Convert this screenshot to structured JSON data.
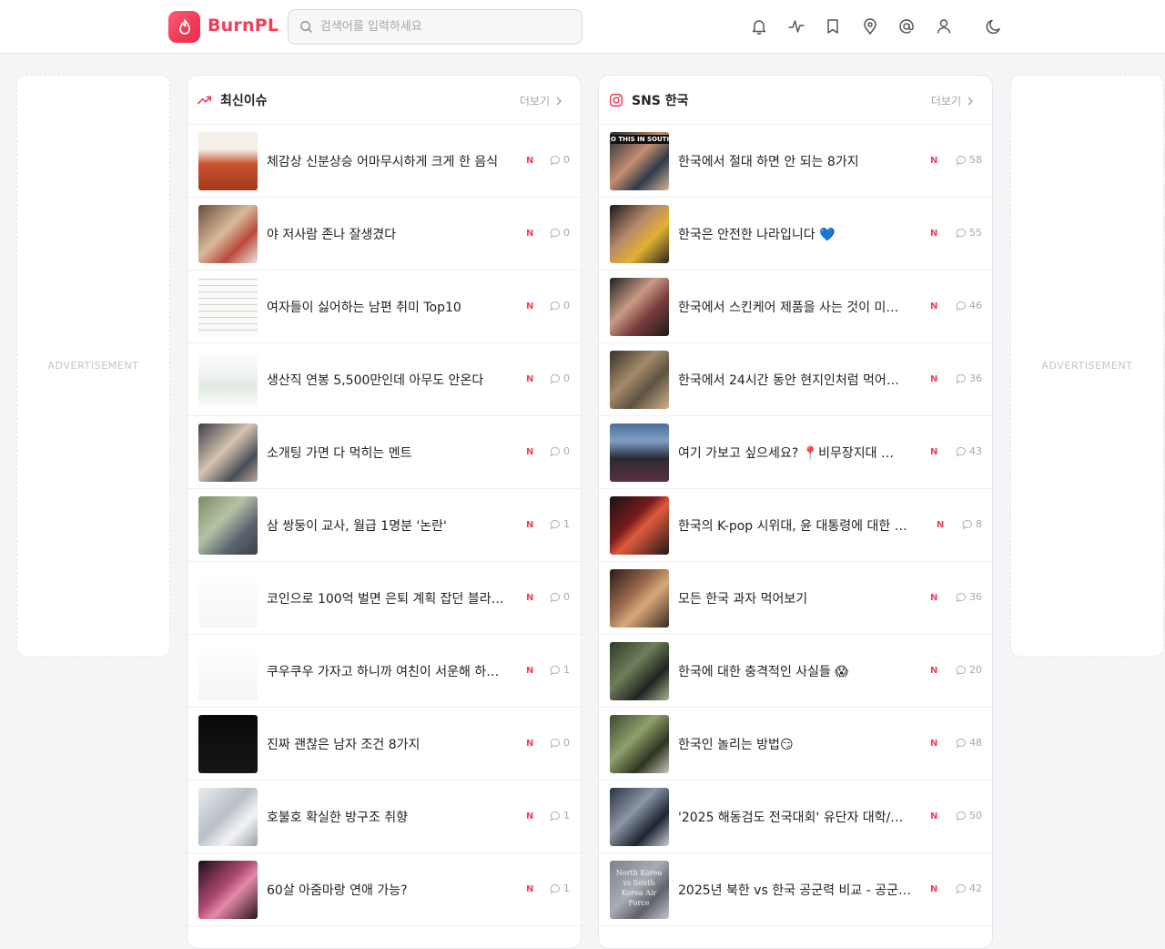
{
  "header": {
    "logo_text": "BurnPL",
    "search_placeholder": "검색어를 입력하세요",
    "icons": [
      "bell-icon",
      "activity-icon",
      "bookmark-icon",
      "map-pin-icon",
      "at-icon",
      "user-icon",
      "moon-icon"
    ]
  },
  "ads": {
    "left_label": "ADVERTISEMENT",
    "right_label": "ADVERTISEMENT"
  },
  "colors": {
    "accent": "#ef3f5c",
    "muted": "#a5a7ad"
  },
  "panels": [
    {
      "title": "최신이슈",
      "more_label": "더보기",
      "icon": "trending-up-icon",
      "items": [
        {
          "title": "체감상 신분상승 어마무시하게 크게 한 음식",
          "badge": "N",
          "comments": "0"
        },
        {
          "title": "야 저사람 존나 잘생겼다",
          "badge": "N",
          "comments": "0"
        },
        {
          "title": "여자들이 싫어하는 남편 취미 Top10",
          "badge": "N",
          "comments": "0"
        },
        {
          "title": "생산직 연봉 5,500만인데 아무도 안온다",
          "badge": "N",
          "comments": "0"
        },
        {
          "title": "소개팅 가면 다 먹히는 멘트",
          "badge": "N",
          "comments": "0"
        },
        {
          "title": "삼 쌍둥이 교사, 월급 1명분 '논란'",
          "badge": "N",
          "comments": "1"
        },
        {
          "title": "코인으로 100억 벌면 은퇴 계획 잡던 블라…",
          "badge": "N",
          "comments": "0"
        },
        {
          "title": "쿠우쿠우 가자고 하니까 여친이 서운해 하…",
          "badge": "N",
          "comments": "1"
        },
        {
          "title": "진짜 괜찮은 남자 조건 8가지",
          "badge": "N",
          "comments": "0"
        },
        {
          "title": "호불호 확실한 방구조 취향",
          "badge": "N",
          "comments": "1"
        },
        {
          "title": "60살 아줌마랑 연애 가능?",
          "badge": "N",
          "comments": "1"
        }
      ]
    },
    {
      "title": "SNS 한국",
      "more_label": "더보기",
      "icon": "instagram-icon",
      "items": [
        {
          "title": "한국에서 절대 하면 안 되는 8가지",
          "badge": "N",
          "comments": "58",
          "thumb_text": "O THIS IN SOUTH KO"
        },
        {
          "title": "한국은 안전한 나라입니다 💙",
          "badge": "N",
          "comments": "55"
        },
        {
          "title": "한국에서 스킨케어 제품을 사는 것이 미…",
          "badge": "N",
          "comments": "46"
        },
        {
          "title": "한국에서 24시간 동안 현지인처럼 먹어…",
          "badge": "N",
          "comments": "36"
        },
        {
          "title": "여기 가보고 싶으세요? 📍비무장지대 …",
          "badge": "N",
          "comments": "43"
        },
        {
          "title": "한국의 K-pop 시위대, 윤 대통령에 대한 …",
          "badge": "N",
          "comments": "8"
        },
        {
          "title": "모든 한국 과자 먹어보기",
          "badge": "N",
          "comments": "36"
        },
        {
          "title": "한국에 대한 충격적인 사실들 😱",
          "badge": "N",
          "comments": "20"
        },
        {
          "title": "한국인 놀리는 방법😏",
          "badge": "N",
          "comments": "48"
        },
        {
          "title": "'2025 해동검도 전국대회' 유단자 대학/…",
          "badge": "N",
          "comments": "50"
        },
        {
          "title": "2025년 북한 vs 한국 공군력 비교 - 공군…",
          "badge": "N",
          "comments": "42",
          "thumb_text": "North Korea vs South Korea Air Force"
        }
      ]
    }
  ]
}
